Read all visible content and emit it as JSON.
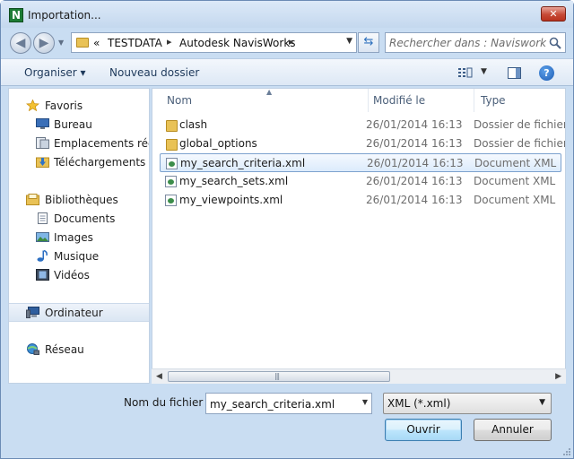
{
  "window": {
    "title": "Importation...",
    "close_label": "✕"
  },
  "address": {
    "overflow": "«",
    "breadcrumbs": [
      "TESTDATA",
      "Autodesk NavisWorks"
    ]
  },
  "search": {
    "placeholder": "Rechercher dans : Navisworks"
  },
  "toolbar": {
    "organize_label": "Organiser ▾",
    "new_folder_label": "Nouveau dossier"
  },
  "sidebar": {
    "favorites_label": "Favoris",
    "favorites": [
      "Bureau",
      "Emplacements récents",
      "Téléchargements"
    ],
    "libraries_label": "Bibliothèques",
    "libraries": [
      "Documents",
      "Images",
      "Musique",
      "Vidéos"
    ],
    "computer_label": "Ordinateur",
    "network_label": "Réseau"
  },
  "columns": {
    "name": "Nom",
    "modified": "Modifié le",
    "type": "Type"
  },
  "files": [
    {
      "name": "clash",
      "date": "26/01/2014 16:13",
      "type": "Dossier de fichiers",
      "icon": "folder-icon"
    },
    {
      "name": "global_options",
      "date": "26/01/2014 16:13",
      "type": "Dossier de fichiers",
      "icon": "folder-icon"
    },
    {
      "name": "my_search_criteria.xml",
      "date": "26/01/2014 16:13",
      "type": "Document XML",
      "icon": "xml-file-icon"
    },
    {
      "name": "my_search_sets.xml",
      "date": "26/01/2014 16:13",
      "type": "Document XML",
      "icon": "xml-file-icon"
    },
    {
      "name": "my_viewpoints.xml",
      "date": "26/01/2014 16:13",
      "type": "Document XML",
      "icon": "xml-file-icon"
    }
  ],
  "bottom": {
    "filename_label": "Nom du fichier :",
    "filename_value": "my_search_criteria.xml",
    "filetype_value": "XML (*.xml)",
    "open_label": "Ouvrir",
    "cancel_label": "Annuler"
  }
}
